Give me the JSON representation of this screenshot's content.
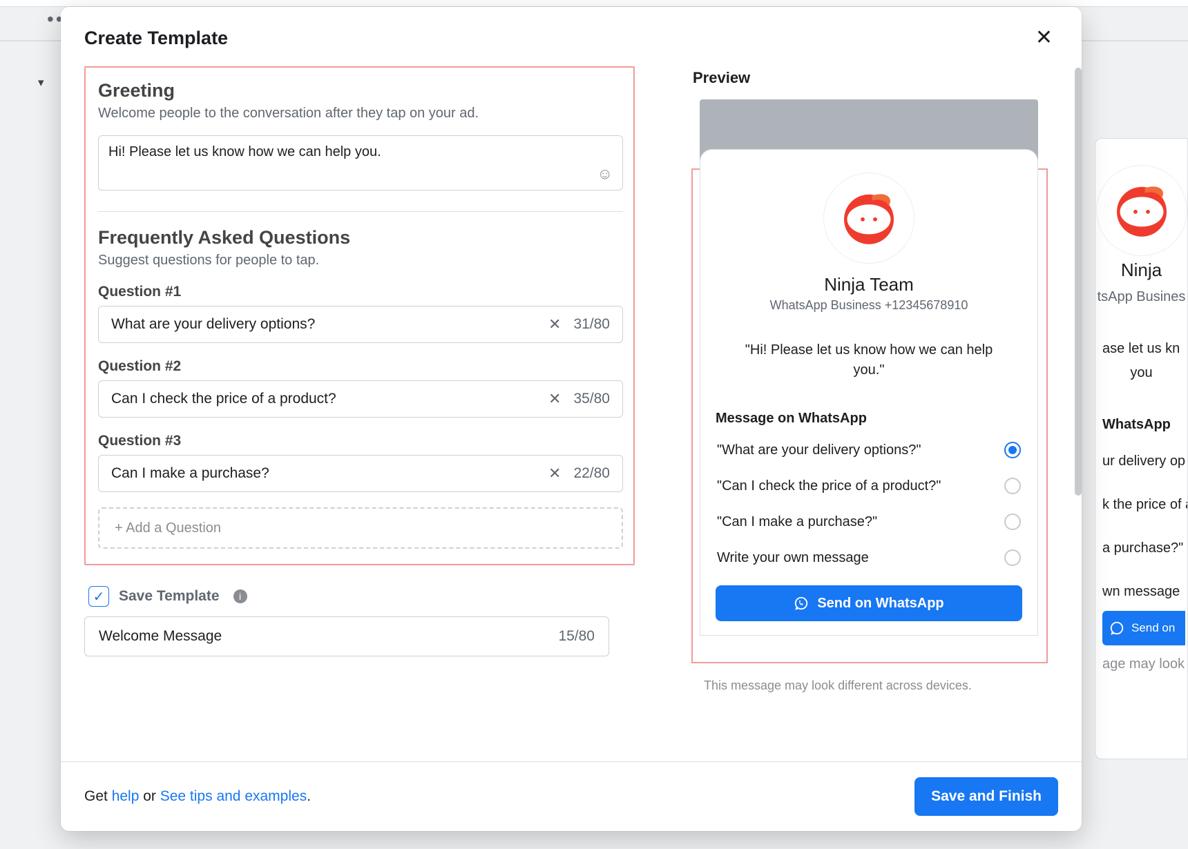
{
  "modal": {
    "title": "Create Template",
    "greeting": {
      "title": "Greeting",
      "subtitle": "Welcome people to the conversation after they tap on your ad.",
      "value": "Hi! Please let us know how we can help you."
    },
    "faq": {
      "title": "Frequently Asked Questions",
      "subtitle": "Suggest questions for people to tap.",
      "max": 80,
      "questions": [
        {
          "label": "Question #1",
          "text": "What are your delivery options?",
          "count": "31/80"
        },
        {
          "label": "Question #2",
          "text": "Can I check the price of a product?",
          "count": "35/80"
        },
        {
          "label": "Question #3",
          "text": "Can I make a purchase?",
          "count": "22/80"
        }
      ],
      "add_label": "+ Add a Question"
    },
    "save_template": {
      "checkbox_checked": true,
      "label": "Save Template",
      "name_value": "Welcome Message",
      "name_count": "15/80"
    }
  },
  "preview": {
    "title": "Preview",
    "brand": "Ninja Team",
    "wb_line": "WhatsApp Business +12345678910",
    "greeting_quote": "\"Hi! Please let us know how we can help you.\"",
    "mow": "Message on WhatsApp",
    "options": [
      {
        "text": "\"What are your delivery options?\"",
        "selected": true
      },
      {
        "text": "\"Can I check the price of a product?\"",
        "selected": false
      },
      {
        "text": "\"Can I make a purchase?\"",
        "selected": false
      },
      {
        "text": "Write your own message",
        "selected": false
      }
    ],
    "send_label": "Send on WhatsApp",
    "disclaimer": "This message may look different across devices."
  },
  "footer": {
    "get": "Get ",
    "help": "help",
    "or": " or ",
    "tips": "See tips and examples",
    "period": ".",
    "save_finish": "Save and Finish"
  },
  "bg": {
    "brand": "Ninja",
    "wb": "tsApp Busines",
    "g1": "ase let us kn",
    "g2": "you",
    "mow": "WhatsApp",
    "o1": "ur delivery op",
    "o2": "k the price of a",
    "o3": "a purchase?\"",
    "o4": "wn message",
    "btn": "Send on",
    "disc": "age may look d"
  }
}
